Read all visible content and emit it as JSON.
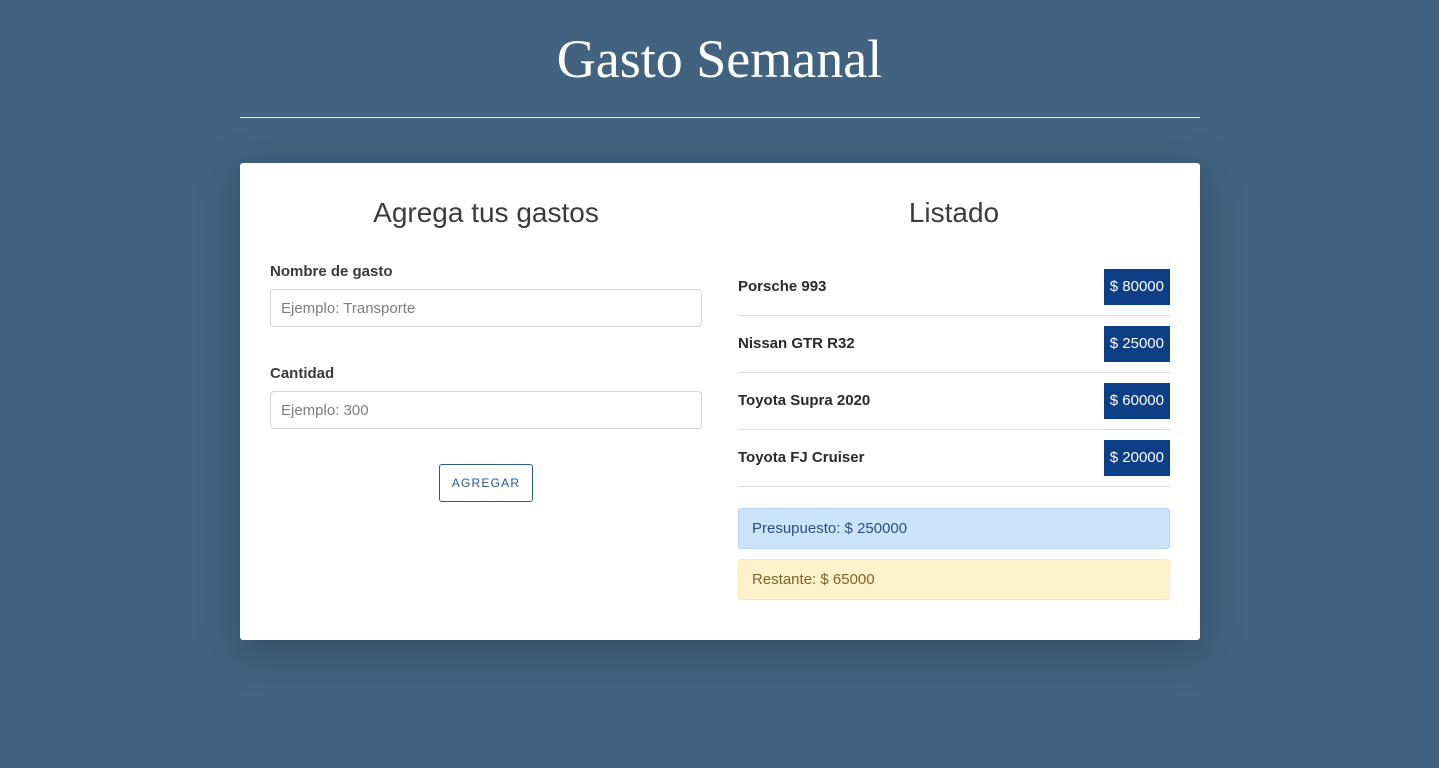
{
  "header": {
    "title": "Gasto Semanal"
  },
  "form": {
    "title": "Agrega tus gastos",
    "name_label": "Nombre de gasto",
    "name_placeholder": "Ejemplo: Transporte",
    "name_value": "",
    "amount_label": "Cantidad",
    "amount_placeholder": "Ejemplo: 300",
    "amount_value": "",
    "submit_label": "Agregar"
  },
  "list": {
    "title": "Listado",
    "items": [
      {
        "name": "Porsche 993",
        "amount": "$ 80000"
      },
      {
        "name": "Nissan GTR R32",
        "amount": "$ 25000"
      },
      {
        "name": "Toyota Supra 2020",
        "amount": "$ 60000"
      },
      {
        "name": "Toyota FJ Cruiser",
        "amount": "$ 20000"
      }
    ],
    "budget_text": "Presupuesto: $ 250000",
    "remaining_text": "Restante: $ 65000"
  },
  "colors": {
    "background": "#41637f",
    "amount_badge": "#0d3f86",
    "budget_alert": "#cce4fb",
    "remaining_alert": "#fff2cb"
  }
}
